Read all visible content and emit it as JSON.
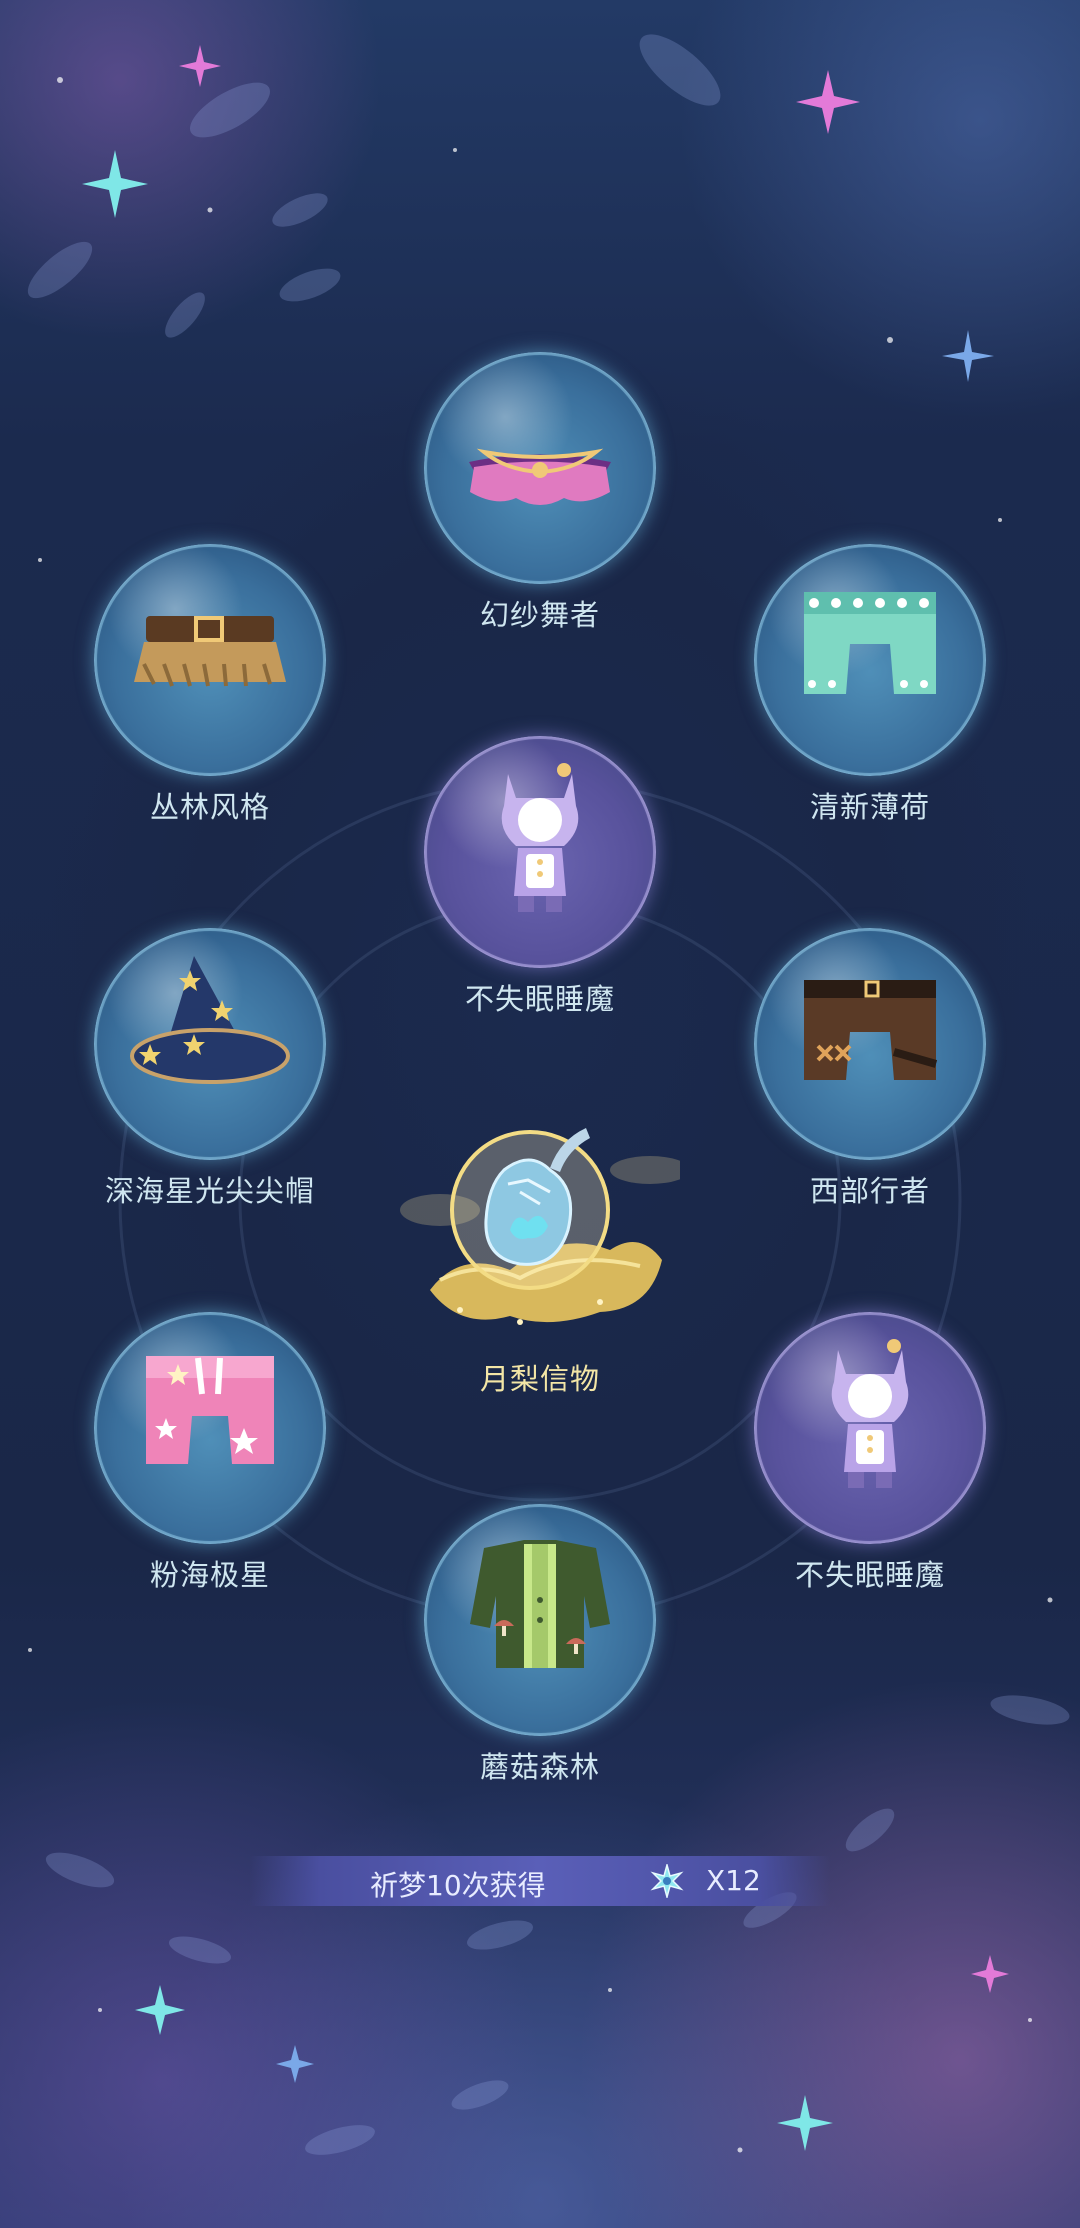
{
  "reward_items": [
    {
      "name": "幻纱舞者",
      "icon": "pink-tutu-skirt-icon",
      "bubble": "blue"
    },
    {
      "name": "丛林风格",
      "icon": "jungle-fringe-skirt-icon",
      "bubble": "blue"
    },
    {
      "name": "清新薄荷",
      "icon": "mint-shorts-icon",
      "bubble": "blue"
    },
    {
      "name": "不失眠睡魔",
      "icon": "sleep-demon-costume-icon",
      "bubble": "purple"
    },
    {
      "name": "深海星光尖尖帽",
      "icon": "star-wizard-hat-icon",
      "bubble": "blue"
    },
    {
      "name": "西部行者",
      "icon": "western-pants-icon",
      "bubble": "blue"
    },
    {
      "name": "粉海极星",
      "icon": "pink-star-pants-icon",
      "bubble": "blue"
    },
    {
      "name": "不失眠睡魔",
      "icon": "sleep-demon-costume-icon",
      "bubble": "purple"
    },
    {
      "name": "蘑菇森林",
      "icon": "mushroom-forest-jacket-icon",
      "bubble": "blue"
    }
  ],
  "featured_item": {
    "name": "月梨信物",
    "icon": "moon-pear-token-icon"
  },
  "reward_banner": {
    "text": "祈梦10次获得",
    "currency_icon": "star-crystal-icon",
    "count": "X12"
  },
  "colors": {
    "background": "#1a2748",
    "bubble_blue": "#3a6f9c",
    "bubble_purple": "#58529c",
    "label": "#cfe6f0",
    "featured_label": "#f3e6a6",
    "banner": "#5a5fb8"
  }
}
